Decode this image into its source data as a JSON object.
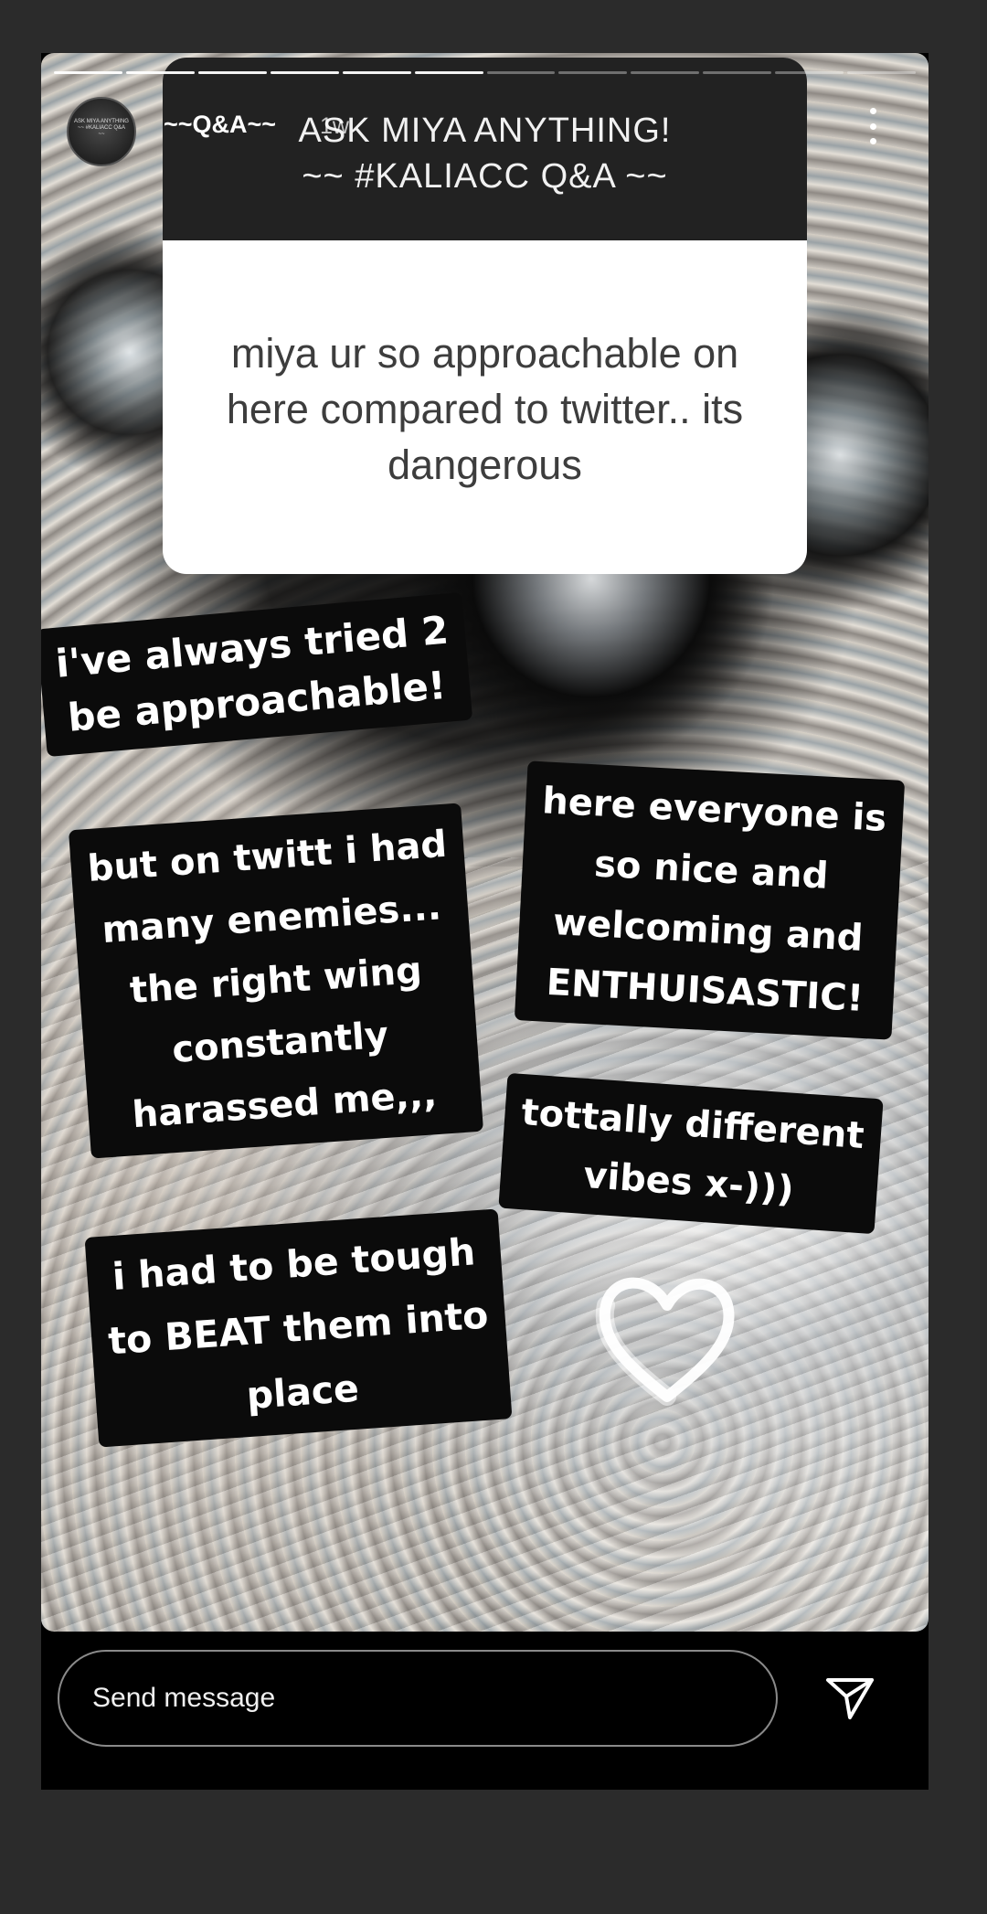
{
  "story": {
    "progress": {
      "total_segments": 12,
      "completed_segments": 6
    },
    "header": {
      "username": "~~Q&A~~",
      "timestamp": "1w",
      "avatar_text": "ASK MIYA ANYTHING ~~ #KALIACC Q&A ~~"
    },
    "qa_card": {
      "title_line1": "ASK MIYA ANYTHING!",
      "title_line2": "~~ #KALIACC Q&A ~~",
      "question": "miya ur so approachable on here compared to twitter.. its dangerous"
    },
    "captions": [
      "i've always tried 2\nbe approachable!",
      "but on twitt i had\nmany enemies...\nthe right wing\nconstantly\nharassed me,,,",
      "here everyone is\nso nice and\nwelcoming and\nENTHUISASTIC!",
      "tottally different\nvibes x-)))",
      "i had to be tough\nto BEAT them into\nplace"
    ],
    "sticker": "heart-icon"
  },
  "footer": {
    "message_placeholder": "Send message",
    "send_icon": "send-icon"
  },
  "colors": {
    "page_background": "#2b2b2b",
    "story_background": "#000000",
    "caption_background": "#0b0b0b",
    "caption_text": "#ffffff"
  }
}
